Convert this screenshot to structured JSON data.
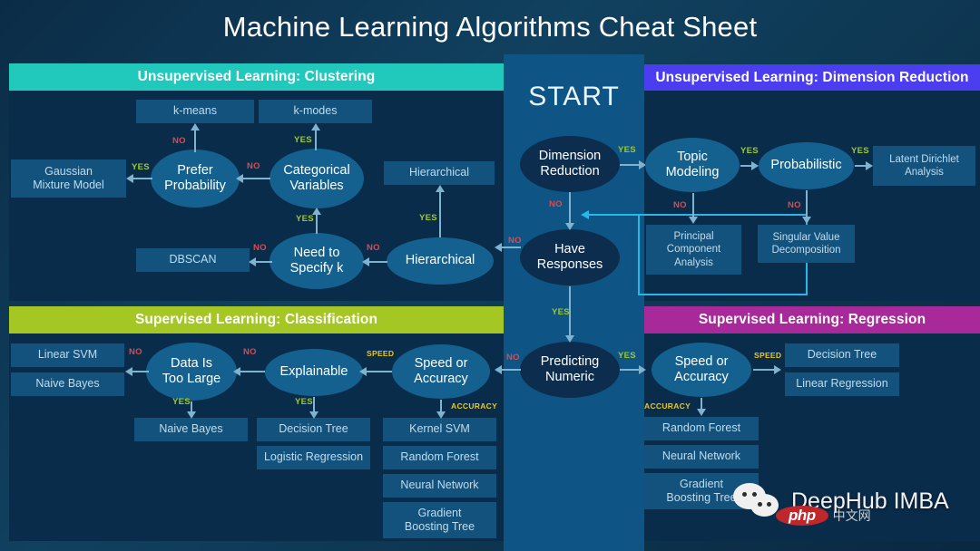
{
  "title": "Machine Learning Algorithms Cheat Sheet",
  "start_label": "START",
  "panels": {
    "clustering": {
      "header": "Unsupervised Learning: Clustering",
      "color": "#21c9bd"
    },
    "dimension": {
      "header": "Unsupervised Learning: Dimension Reduction",
      "color": "#4a3ef0"
    },
    "classification": {
      "header": "Supervised Learning: Classification",
      "color": "#a4c723"
    },
    "regression": {
      "header": "Supervised Learning: Regression",
      "color": "#a82a9a"
    }
  },
  "center": {
    "nodes": [
      {
        "label": "Dimension\nReduction",
        "line1": "Dimension",
        "line2": "Reduction"
      },
      {
        "label": "Have\nResponses",
        "line1": "Have",
        "line2": "Responses"
      },
      {
        "label": "Predicting\nNumeric",
        "line1": "Predicting",
        "line2": "Numeric"
      }
    ],
    "edges": [
      {
        "from": "Dimension Reduction",
        "to": "Topic Modeling",
        "label": "YES"
      },
      {
        "from": "Dimension Reduction",
        "to": "Have Responses",
        "label": "NO"
      },
      {
        "from": "Have Responses",
        "to": "Hierarchical",
        "label": "NO"
      },
      {
        "from": "Have Responses",
        "to": "Predicting Numeric",
        "label": "YES"
      },
      {
        "from": "Predicting Numeric",
        "to": "Speed or Accuracy (Classification)",
        "label": "NO"
      },
      {
        "from": "Predicting Numeric",
        "to": "Speed or Accuracy (Regression)",
        "label": "YES"
      }
    ]
  },
  "clustering": {
    "boxes": [
      {
        "id": "kmeans",
        "label": "k-means"
      },
      {
        "id": "kmodes",
        "label": "k-modes"
      },
      {
        "id": "gmm",
        "line1": "Gaussian",
        "line2": "Mixture Model"
      },
      {
        "id": "hier-box",
        "label": "Hierarchical"
      },
      {
        "id": "dbscan",
        "label": "DBSCAN"
      }
    ],
    "ellipses": [
      {
        "id": "prefer-prob",
        "line1": "Prefer",
        "line2": "Probability"
      },
      {
        "id": "cat-vars",
        "line1": "Categorical",
        "line2": "Variables"
      },
      {
        "id": "need-k",
        "line1": "Need to",
        "line2": "Specify k"
      },
      {
        "id": "hier-ell",
        "label": "Hierarchical"
      }
    ],
    "edges": [
      {
        "from": "Prefer Probability",
        "to": "k-means",
        "label": "NO"
      },
      {
        "from": "Prefer Probability",
        "to": "Gaussian Mixture Model",
        "label": "YES"
      },
      {
        "from": "Categorical Variables",
        "to": "k-modes",
        "label": "YES"
      },
      {
        "from": "Categorical Variables",
        "to": "Prefer Probability",
        "label": "NO"
      },
      {
        "from": "Need to Specify k",
        "to": "Categorical Variables",
        "label": "YES"
      },
      {
        "from": "Need to Specify k",
        "to": "DBSCAN",
        "label": "NO"
      },
      {
        "from": "Hierarchical",
        "to": "Hierarchical (box)",
        "label": "YES"
      },
      {
        "from": "Hierarchical",
        "to": "Need to Specify k",
        "label": "NO"
      }
    ]
  },
  "dimension": {
    "ellipses": [
      {
        "id": "topic-modeling",
        "line1": "Topic",
        "line2": "Modeling"
      },
      {
        "id": "probabilistic",
        "label": "Probabilistic"
      }
    ],
    "boxes": [
      {
        "id": "lda",
        "line1": "Latent Dirichlet",
        "line2": "Analysis"
      },
      {
        "id": "pca",
        "line1": "Principal",
        "line2": "Component",
        "line3": "Analysis"
      },
      {
        "id": "svd",
        "line1": "Singular Value",
        "line2": "Decomposition"
      }
    ],
    "edges": [
      {
        "from": "Topic Modeling",
        "to": "Probabilistic",
        "label": "YES"
      },
      {
        "from": "Topic Modeling",
        "to": "Principal Component Analysis",
        "label": "NO"
      },
      {
        "from": "Probabilistic",
        "to": "Latent Dirichlet Analysis",
        "label": "YES"
      },
      {
        "from": "Probabilistic",
        "to": "Singular Value Decomposition",
        "label": "NO"
      }
    ]
  },
  "classification": {
    "ellipses": [
      {
        "id": "data-too-large",
        "line1": "Data Is",
        "line2": "Too Large"
      },
      {
        "id": "explainable",
        "label": "Explainable"
      },
      {
        "id": "speed-acc-c",
        "line1": "Speed or",
        "line2": "Accuracy"
      }
    ],
    "boxes": [
      {
        "id": "linear-svm",
        "label": "Linear SVM"
      },
      {
        "id": "naive-bayes-left",
        "label": "Naive Bayes"
      },
      {
        "id": "naive-bayes",
        "label": "Naive Bayes"
      },
      {
        "id": "decision-tree",
        "label": "Decision Tree"
      },
      {
        "id": "logistic-reg",
        "label": "Logistic Regression"
      },
      {
        "id": "kernel-svm",
        "label": "Kernel SVM"
      },
      {
        "id": "random-forest",
        "label": "Random Forest"
      },
      {
        "id": "neural-net",
        "label": "Neural Network"
      },
      {
        "id": "gbt",
        "line1": "Gradient",
        "line2": "Boosting Tree"
      }
    ],
    "edges": [
      {
        "from": "Data Is Too Large",
        "to": "Linear SVM / Naive Bayes",
        "label": "NO"
      },
      {
        "from": "Data Is Too Large",
        "to": "Naive Bayes",
        "label": "YES"
      },
      {
        "from": "Explainable",
        "to": "Data Is Too Large",
        "label": "NO"
      },
      {
        "from": "Explainable",
        "to": "Decision Tree / Logistic Regression",
        "label": "YES"
      },
      {
        "from": "Speed or Accuracy",
        "to": "Explainable",
        "label": "SPEED"
      },
      {
        "from": "Speed or Accuracy",
        "to": "Kernel SVM group",
        "label": "ACCURACY"
      }
    ]
  },
  "regression": {
    "ellipses": [
      {
        "id": "speed-acc-r",
        "line1": "Speed or",
        "line2": "Accuracy"
      }
    ],
    "boxes": [
      {
        "id": "r-decision-tree",
        "label": "Decision Tree"
      },
      {
        "id": "r-linear-reg",
        "label": "Linear Regression"
      },
      {
        "id": "r-random-forest",
        "label": "Random Forest"
      },
      {
        "id": "r-neural-net",
        "label": "Neural Network"
      },
      {
        "id": "r-gbt",
        "line1": "Gradient",
        "line2": "Boosting Tree"
      }
    ],
    "edges": [
      {
        "from": "Speed or Accuracy",
        "to": "Decision Tree / Linear Regression",
        "label": "SPEED"
      },
      {
        "from": "Speed or Accuracy",
        "to": "Random Forest group",
        "label": "ACCURACY"
      }
    ]
  },
  "labels": {
    "yes": "YES",
    "no": "NO",
    "speed": "SPEED",
    "accuracy": "ACCURACY"
  },
  "watermark": {
    "text": "DeepHub IMBA",
    "badge": "php",
    "badge_suffix": "中文网"
  },
  "colors": {
    "background": "#0b2c47",
    "panel": "#0a2c4b",
    "center_strip": "#0e5585",
    "box": "#14527e",
    "ellipse": "#14618f",
    "ellipse_dark": "#0d2d4e",
    "yes": "#9ec92b",
    "no": "#d94b52",
    "speed_accuracy": "#e8c821",
    "connector": "#27b7e8",
    "arrow": "#7fb3cf"
  }
}
